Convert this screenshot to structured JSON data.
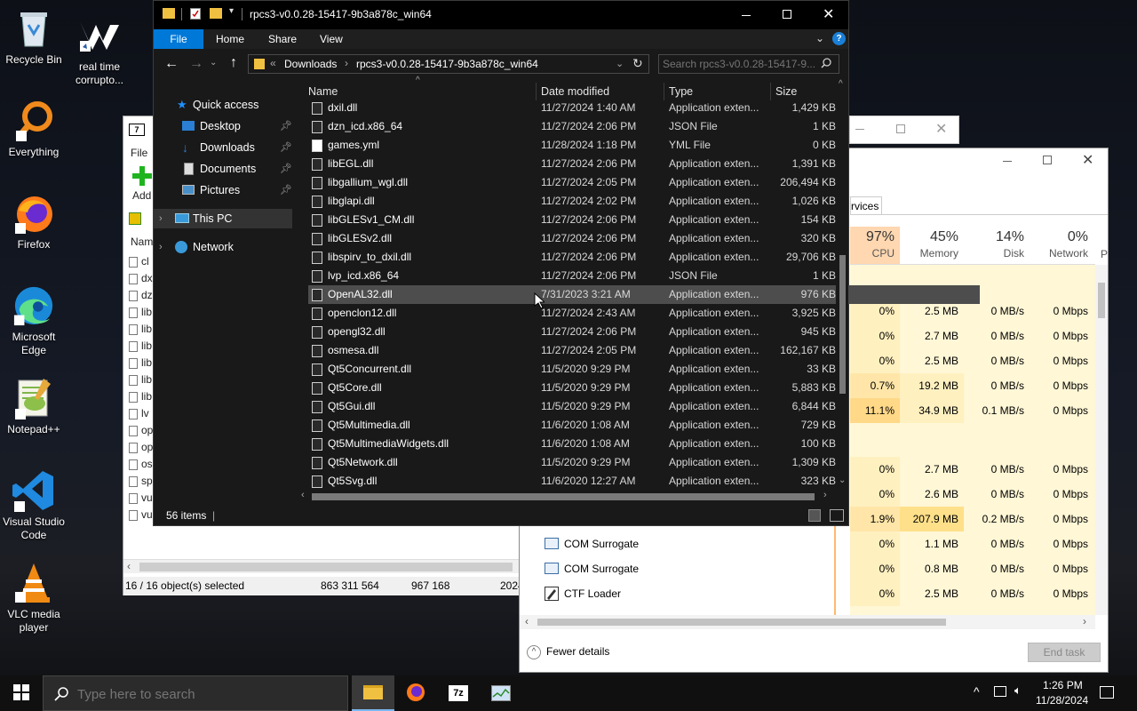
{
  "desktop": {
    "icons": [
      {
        "label": "Recycle Bin",
        "name": "recycle-bin"
      },
      {
        "label": "real time corrupto...",
        "name": "real-time-corrupto"
      },
      {
        "label": "Everything",
        "name": "everything"
      },
      {
        "label": "Firefox",
        "name": "firefox"
      },
      {
        "label": "Microsoft Edge",
        "name": "microsoft-edge"
      },
      {
        "label": "Notepad++",
        "name": "notepad-plus-plus"
      },
      {
        "label": "Visual Studio Code",
        "name": "vscode"
      },
      {
        "label": "VLC media player",
        "name": "vlc"
      }
    ]
  },
  "sevenzip": {
    "menu_file": "File",
    "add_label": "Add",
    "col_name": "Name",
    "rows": [
      "cl",
      "dx",
      "dz",
      "lib",
      "lib",
      "lib",
      "lib",
      "lib",
      "lib",
      "lv",
      "op",
      "op",
      "os",
      "sp",
      "vu",
      "vu"
    ],
    "status_selected": "16 / 16 object(s) selected",
    "status_size": "863 311 564",
    "status_packed": "967 168",
    "status_date": "2024"
  },
  "taskmanager": {
    "tab_services": "rvices",
    "headers": [
      {
        "pct": "97%",
        "name": "CPU"
      },
      {
        "pct": "45%",
        "name": "Memory"
      },
      {
        "pct": "14%",
        "name": "Disk"
      },
      {
        "pct": "0%",
        "name": "Network"
      },
      {
        "pct": "",
        "name": "P"
      }
    ],
    "rows": [
      {
        "cpu": "0%",
        "mem": "2.5 MB",
        "disk": "0 MB/s",
        "net": "0 Mbps"
      },
      {
        "cpu": "0%",
        "mem": "2.7 MB",
        "disk": "0 MB/s",
        "net": "0 Mbps"
      },
      {
        "cpu": "0%",
        "mem": "2.5 MB",
        "disk": "0 MB/s",
        "net": "0 Mbps"
      },
      {
        "cpu": "0.7%",
        "mem": "19.2 MB",
        "disk": "0 MB/s",
        "net": "0 Mbps"
      },
      {
        "cpu": "11.1%",
        "mem": "34.9 MB",
        "disk": "0.1 MB/s",
        "net": "0 Mbps"
      },
      {
        "cpu": "",
        "mem": "",
        "disk": "",
        "net": ""
      },
      {
        "cpu": "0%",
        "mem": "2.7 MB",
        "disk": "0 MB/s",
        "net": "0 Mbps"
      },
      {
        "cpu": "0%",
        "mem": "2.6 MB",
        "disk": "0 MB/s",
        "net": "0 Mbps"
      },
      {
        "cpu": "1.9%",
        "mem": "207.9 MB",
        "disk": "0.2 MB/s",
        "net": "0 Mbps"
      },
      {
        "name": "COM Surrogate",
        "cpu": "0%",
        "mem": "1.1 MB",
        "disk": "0 MB/s",
        "net": "0 Mbps"
      },
      {
        "name": "COM Surrogate",
        "cpu": "0%",
        "mem": "0.8 MB",
        "disk": "0 MB/s",
        "net": "0 Mbps"
      },
      {
        "name": "CTF Loader",
        "cpu": "0%",
        "mem": "2.5 MB",
        "disk": "0 MB/s",
        "net": "0 Mbps"
      }
    ],
    "fewer_details": "Fewer details",
    "end_task": "End task"
  },
  "explorer": {
    "title": "rpcs3-v0.0.28-15417-9b3a878c_win64",
    "tabs": [
      "File",
      "Home",
      "Share",
      "View"
    ],
    "breadcrumb": [
      "Downloads",
      "rpcs3-v0.0.28-15417-9b3a878c_win64"
    ],
    "search_placeholder": "Search rpcs3-v0.0.28-15417-9...",
    "nav": [
      {
        "label": "Quick access",
        "name": "quick-access"
      },
      {
        "label": "Desktop",
        "name": "desktop"
      },
      {
        "label": "Downloads",
        "name": "downloads"
      },
      {
        "label": "Documents",
        "name": "documents"
      },
      {
        "label": "Pictures",
        "name": "pictures"
      },
      {
        "label": "This PC",
        "name": "this-pc"
      },
      {
        "label": "Network",
        "name": "network"
      }
    ],
    "columns": {
      "name": "Name",
      "date": "Date modified",
      "type": "Type",
      "size": "Size"
    },
    "files": [
      {
        "name": "dxil.dll",
        "date": "11/27/2024 1:40 AM",
        "type": "Application exten...",
        "size": "1,429 KB"
      },
      {
        "name": "dzn_icd.x86_64",
        "date": "11/27/2024 2:06 PM",
        "type": "JSON File",
        "size": "1 KB"
      },
      {
        "name": "games.yml",
        "date": "11/28/2024 1:18 PM",
        "type": "YML File",
        "size": "0 KB"
      },
      {
        "name": "libEGL.dll",
        "date": "11/27/2024 2:06 PM",
        "type": "Application exten...",
        "size": "1,391 KB"
      },
      {
        "name": "libgallium_wgl.dll",
        "date": "11/27/2024 2:05 PM",
        "type": "Application exten...",
        "size": "206,494 KB"
      },
      {
        "name": "libglapi.dll",
        "date": "11/27/2024 2:02 PM",
        "type": "Application exten...",
        "size": "1,026 KB"
      },
      {
        "name": "libGLESv1_CM.dll",
        "date": "11/27/2024 2:06 PM",
        "type": "Application exten...",
        "size": "154 KB"
      },
      {
        "name": "libGLESv2.dll",
        "date": "11/27/2024 2:06 PM",
        "type": "Application exten...",
        "size": "320 KB"
      },
      {
        "name": "libspirv_to_dxil.dll",
        "date": "11/27/2024 2:06 PM",
        "type": "Application exten...",
        "size": "29,706 KB"
      },
      {
        "name": "lvp_icd.x86_64",
        "date": "11/27/2024 2:06 PM",
        "type": "JSON File",
        "size": "1 KB"
      },
      {
        "name": "OpenAL32.dll",
        "date": "7/31/2023 3:21 AM",
        "type": "Application exten...",
        "size": "976 KB"
      },
      {
        "name": "openclon12.dll",
        "date": "11/27/2024 2:43 AM",
        "type": "Application exten...",
        "size": "3,925 KB"
      },
      {
        "name": "opengl32.dll",
        "date": "11/27/2024 2:06 PM",
        "type": "Application exten...",
        "size": "945 KB"
      },
      {
        "name": "osmesa.dll",
        "date": "11/27/2024 2:05 PM",
        "type": "Application exten...",
        "size": "162,167 KB"
      },
      {
        "name": "Qt5Concurrent.dll",
        "date": "11/5/2020 9:29 PM",
        "type": "Application exten...",
        "size": "33 KB"
      },
      {
        "name": "Qt5Core.dll",
        "date": "11/5/2020 9:29 PM",
        "type": "Application exten...",
        "size": "5,883 KB"
      },
      {
        "name": "Qt5Gui.dll",
        "date": "11/5/2020 9:29 PM",
        "type": "Application exten...",
        "size": "6,844 KB"
      },
      {
        "name": "Qt5Multimedia.dll",
        "date": "11/6/2020 1:08 AM",
        "type": "Application exten...",
        "size": "729 KB"
      },
      {
        "name": "Qt5MultimediaWidgets.dll",
        "date": "11/6/2020 1:08 AM",
        "type": "Application exten...",
        "size": "100 KB"
      },
      {
        "name": "Qt5Network.dll",
        "date": "11/5/2020 9:29 PM",
        "type": "Application exten...",
        "size": "1,309 KB"
      },
      {
        "name": "Qt5Svg.dll",
        "date": "11/6/2020 12:27 AM",
        "type": "Application exten...",
        "size": "323 KB"
      }
    ],
    "status_items": "56 items",
    "status_sep": "|"
  },
  "taskbar": {
    "search_placeholder": "Type here to search",
    "time": "1:26 PM",
    "date": "11/28/2024"
  },
  "colors": {
    "accent": "#0078d7",
    "explorer_bg": "#191919",
    "cpu_heat": "#ffd080",
    "cell_heat": "#fff4c4"
  }
}
